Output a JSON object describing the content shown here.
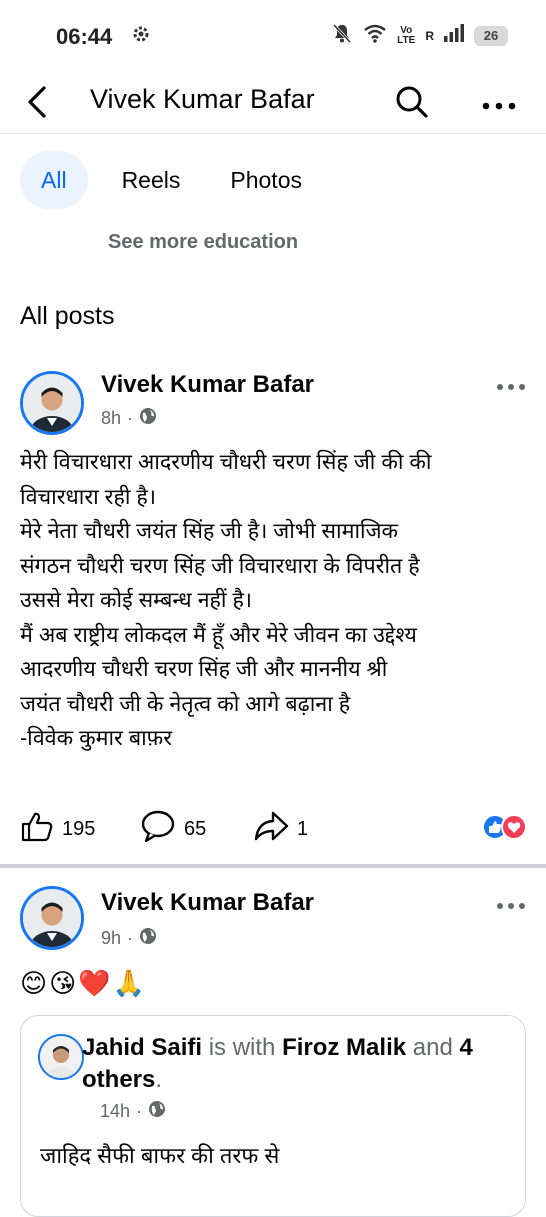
{
  "status_bar": {
    "time": "06:44",
    "network_label_top": "Vo",
    "network_label_bottom": "LTE",
    "roaming": "R",
    "battery": "26",
    "icons": [
      "gear-icon",
      "mute-icon",
      "wifi-icon",
      "signal-icon",
      "battery-icon"
    ]
  },
  "header": {
    "title": "Vivek Kumar Bafar",
    "icons": [
      "back-arrow-icon",
      "search-icon",
      "more-icon"
    ]
  },
  "tabs": [
    {
      "label": "All",
      "active": true
    },
    {
      "label": "Reels",
      "active": false
    },
    {
      "label": "Photos",
      "active": false
    }
  ],
  "see_more": "See more education",
  "section_title": "All posts",
  "posts": [
    {
      "author": "Vivek Kumar Bafar",
      "time": "8h",
      "text_lines": [
        "मेरी विचारधारा आदरणीय चौधरी चरण सिंह जी की की",
        "विचारधारा रही है।",
        "मेरे नेता चौधरी जयंत सिंह जी है। जोभी सामाजिक",
        "संगठन चौधरी चरण सिंह जी विचारधारा के विपरीत है",
        "उससे मेरा कोई सम्बन्ध नहीं है।",
        "मैं अब राष्ट्रीय लोकदल मैं हूँ और मेरे जीवन का उद्देश्य",
        "आदरणीय चौधरी चरण सिंह जी और माननीय श्री",
        "जयंत चौधरी जी के नेतृत्व को आगे बढ़ाना है",
        "-विवेक कुमार बाफ़र"
      ],
      "likes": "195",
      "comments": "65",
      "shares": "1"
    },
    {
      "author": "Vivek Kumar Bafar",
      "time": "9h",
      "emojis": "😊😘❤️🙏",
      "shared": {
        "author": "Jahid Saifi",
        "with_text": " is with ",
        "tagged": "Firoz Malik",
        "and_text": " and ",
        "others": "4 others",
        "period": ".",
        "time": "14h",
        "text": "जाहिद सैफी बाफर की तरफ से"
      }
    }
  ],
  "colors": {
    "accent": "#0866ff",
    "tab_active_bg": "#ebf3ff",
    "secondary_text": "#65676b",
    "like_blue": "#1877f2",
    "love_red": "#f33e58"
  }
}
